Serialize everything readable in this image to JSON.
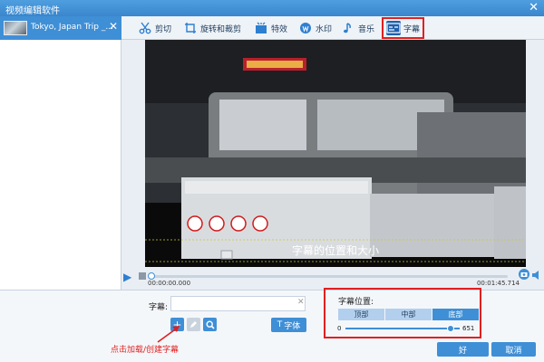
{
  "window": {
    "title": "视频编辑软件",
    "close": "✕"
  },
  "sidebar": {
    "file_name": "Tokyo, Japan Trip _...",
    "close": "✕"
  },
  "toolbar": {
    "tools": [
      {
        "label": "剪切",
        "icon": "scissors-icon"
      },
      {
        "label": "旋转和裁剪",
        "icon": "rotate-crop-icon"
      },
      {
        "label": "特效",
        "icon": "effects-icon"
      },
      {
        "label": "水印",
        "icon": "watermark-icon"
      },
      {
        "label": "音乐",
        "icon": "music-note-icon"
      },
      {
        "label": "字幕",
        "icon": "subtitle-icon",
        "active": true
      }
    ],
    "active_color": "#e02020"
  },
  "preview": {
    "subtitle_text": "字幕的位置和大小"
  },
  "timeline": {
    "time_start": "00:00:00.000",
    "time_end": "00:01:45.714"
  },
  "subtitle_panel": {
    "label": "字幕:",
    "input_value": "",
    "clear": "✕",
    "font_button": "字体",
    "font_icon": "T"
  },
  "position_panel": {
    "title": "字幕位置:",
    "options": [
      "顶部",
      "中部",
      "底部"
    ],
    "selected": "底部",
    "min": "0",
    "max": "651",
    "value": 600
  },
  "hint": "点击加载/创建字幕",
  "buttons": {
    "ok": "好",
    "cancel": "取消"
  },
  "colors": {
    "accent": "#3f8fd6",
    "highlight": "#e02020"
  }
}
